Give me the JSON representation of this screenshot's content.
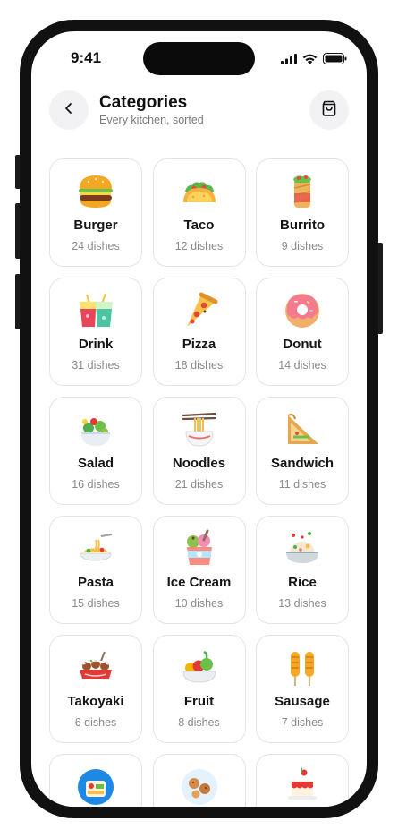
{
  "status": {
    "time": "9:41"
  },
  "header": {
    "title": "Categories",
    "subtitle": "Every kitchen, sorted"
  },
  "categories": [
    {
      "name": "Burger",
      "count": "24 dishes",
      "icon": "burger-icon"
    },
    {
      "name": "Taco",
      "count": "12 dishes",
      "icon": "taco-icon"
    },
    {
      "name": "Burrito",
      "count": "9 dishes",
      "icon": "burrito-icon"
    },
    {
      "name": "Drink",
      "count": "31 dishes",
      "icon": "drink-icon"
    },
    {
      "name": "Pizza",
      "count": "18 dishes",
      "icon": "pizza-icon"
    },
    {
      "name": "Donut",
      "count": "14 dishes",
      "icon": "donut-icon"
    },
    {
      "name": "Salad",
      "count": "16 dishes",
      "icon": "salad-icon"
    },
    {
      "name": "Noodles",
      "count": "21 dishes",
      "icon": "noodles-icon"
    },
    {
      "name": "Sandwich",
      "count": "11 dishes",
      "icon": "sandwich-icon"
    },
    {
      "name": "Pasta",
      "count": "15 dishes",
      "icon": "pasta-icon"
    },
    {
      "name": "Ice Cream",
      "count": "10 dishes",
      "icon": "ice-cream-icon"
    },
    {
      "name": "Rice",
      "count": "13 dishes",
      "icon": "rice-icon"
    },
    {
      "name": "Takoyaki",
      "count": "6 dishes",
      "icon": "takoyaki-icon"
    },
    {
      "name": "Fruit",
      "count": "8 dishes",
      "icon": "fruit-icon"
    },
    {
      "name": "Sausage",
      "count": "7 dishes",
      "icon": "sausage-icon"
    }
  ],
  "partial_row_icons": [
    "bento-icon",
    "cookies-icon",
    "cake-icon"
  ]
}
